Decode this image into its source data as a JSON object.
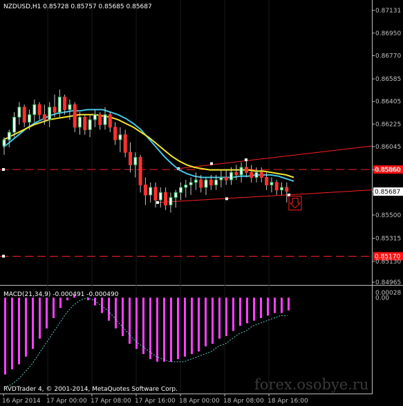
{
  "title": "NZDUSD,H1  0.85728 0.85757 0.85685 0.85687",
  "colors": {
    "background": "#000000",
    "bull_candle": "#20b050",
    "bear_candle": "#ff3030",
    "ma_fast": "#44c8e8",
    "ma_slow": "#f5e82a",
    "trend_lines": "#ff2020",
    "macd_hist": "#ff40ff",
    "macd_signal": "#60d0d0"
  },
  "chart_data": [
    {
      "type": "candlestick",
      "symbol": "NZDUSD",
      "timeframe": "H1",
      "ohlc_header": {
        "open": 0.85728,
        "high": 0.85757,
        "low": 0.85685,
        "close": 0.85687
      },
      "ylim": [
        0.84965,
        0.87131
      ],
      "y_ticks": [
        "0.87131",
        "0.86950",
        "0.86770",
        "0.86585",
        "0.86405",
        "0.86225",
        "0.86045",
        "0.85860",
        "0.85687",
        "0.85500",
        "0.85315",
        "0.85130",
        "0.84965"
      ],
      "current_price": "0.85687",
      "highlight_levels": [
        {
          "label": "0.85860",
          "value": 0.85863
        },
        {
          "label": "0.85170",
          "value": 0.85172
        }
      ],
      "x_labels": [
        "16 Apr 2014",
        "17 Apr 00:00",
        "17 Apr 08:00",
        "17 Apr 16:00",
        "18 Apr 00:00",
        "18 Apr 08:00",
        "18 Apr 16:00"
      ],
      "candles": [
        [
          0.8605,
          0.8612,
          0.8598,
          0.861
        ],
        [
          0.861,
          0.8618,
          0.8604,
          0.8616
        ],
        [
          0.8616,
          0.8632,
          0.8612,
          0.8628
        ],
        [
          0.8628,
          0.864,
          0.8622,
          0.8636
        ],
        [
          0.8636,
          0.8638,
          0.862,
          0.8624
        ],
        [
          0.8624,
          0.8634,
          0.8618,
          0.863
        ],
        [
          0.863,
          0.8642,
          0.8624,
          0.8638
        ],
        [
          0.8638,
          0.864,
          0.8626,
          0.863
        ],
        [
          0.863,
          0.8638,
          0.8622,
          0.8626
        ],
        [
          0.8626,
          0.864,
          0.862,
          0.8636
        ],
        [
          0.8636,
          0.8646,
          0.8628,
          0.8632
        ],
        [
          0.8632,
          0.865,
          0.8628,
          0.8644
        ],
        [
          0.8644,
          0.8646,
          0.863,
          0.8634
        ],
        [
          0.8634,
          0.8642,
          0.8626,
          0.8638
        ],
        [
          0.8638,
          0.864,
          0.8616,
          0.862
        ],
        [
          0.862,
          0.8632,
          0.8614,
          0.8628
        ],
        [
          0.8628,
          0.863,
          0.8614,
          0.8618
        ],
        [
          0.8618,
          0.863,
          0.8612,
          0.8626
        ],
        [
          0.8626,
          0.8634,
          0.862,
          0.863
        ],
        [
          0.863,
          0.8632,
          0.8618,
          0.8622
        ],
        [
          0.8622,
          0.8636,
          0.8618,
          0.863
        ],
        [
          0.863,
          0.8632,
          0.8616,
          0.862
        ],
        [
          0.862,
          0.8624,
          0.8606,
          0.861
        ],
        [
          0.861,
          0.862,
          0.86,
          0.8614
        ],
        [
          0.8614,
          0.8618,
          0.8596,
          0.86
        ],
        [
          0.86,
          0.8608,
          0.8584,
          0.859
        ],
        [
          0.859,
          0.86,
          0.858,
          0.8596
        ],
        [
          0.8596,
          0.8598,
          0.8568,
          0.8574
        ],
        [
          0.8574,
          0.858,
          0.8558,
          0.8566
        ],
        [
          0.8566,
          0.8576,
          0.856,
          0.8572
        ],
        [
          0.8572,
          0.8576,
          0.8556,
          0.8562
        ],
        [
          0.8562,
          0.8572,
          0.8556,
          0.8568
        ],
        [
          0.8568,
          0.8572,
          0.8554,
          0.8558
        ],
        [
          0.8558,
          0.8568,
          0.8552,
          0.8564
        ],
        [
          0.8564,
          0.857,
          0.8556,
          0.8568
        ],
        [
          0.8568,
          0.8576,
          0.8562,
          0.8572
        ],
        [
          0.8572,
          0.8578,
          0.8564,
          0.8574
        ],
        [
          0.8574,
          0.858,
          0.8566,
          0.8576
        ],
        [
          0.8576,
          0.8584,
          0.857,
          0.8578
        ],
        [
          0.8578,
          0.8582,
          0.8568,
          0.8572
        ],
        [
          0.8572,
          0.858,
          0.8566,
          0.8578
        ],
        [
          0.8578,
          0.8582,
          0.857,
          0.8574
        ],
        [
          0.8574,
          0.8582,
          0.857,
          0.8578
        ],
        [
          0.8578,
          0.8586,
          0.8572,
          0.858
        ],
        [
          0.858,
          0.8586,
          0.8574,
          0.8578
        ],
        [
          0.8578,
          0.8588,
          0.8574,
          0.8584
        ],
        [
          0.8584,
          0.859,
          0.8578,
          0.8582
        ],
        [
          0.8582,
          0.8592,
          0.8576,
          0.8588
        ],
        [
          0.8588,
          0.8594,
          0.858,
          0.8584
        ],
        [
          0.8584,
          0.859,
          0.8576,
          0.858
        ],
        [
          0.858,
          0.8588,
          0.8576,
          0.8584
        ],
        [
          0.8584,
          0.8588,
          0.8576,
          0.858
        ],
        [
          0.858,
          0.8584,
          0.857,
          0.8574
        ],
        [
          0.8574,
          0.858,
          0.8568,
          0.8576
        ],
        [
          0.8576,
          0.8578,
          0.8566,
          0.857
        ],
        [
          0.857,
          0.8576,
          0.8566,
          0.8572
        ],
        [
          0.8572,
          0.8576,
          0.856,
          0.8569
        ]
      ],
      "moving_averages": [
        {
          "color": "ma_fast",
          "values": [
            0.8604,
            0.8609,
            0.8614,
            0.8619,
            0.8623,
            0.8626,
            0.8629,
            0.8631,
            0.8632,
            0.8633,
            0.8633,
            0.8634,
            0.8634,
            0.8634,
            0.8632,
            0.863,
            0.8627,
            0.8623,
            0.8618,
            0.8611,
            0.8604,
            0.8597,
            0.8591,
            0.8586,
            0.8583,
            0.8581,
            0.858,
            0.858,
            0.858,
            0.858,
            0.858,
            0.8581,
            0.8581,
            0.8582,
            0.8582,
            0.8582,
            0.8581,
            0.8579,
            0.8577
          ]
        },
        {
          "color": "ma_slow",
          "values": [
            0.861,
            0.8613,
            0.8616,
            0.8619,
            0.8622,
            0.8624,
            0.8626,
            0.8627,
            0.8628,
            0.8629,
            0.863,
            0.863,
            0.863,
            0.8629,
            0.8628,
            0.8626,
            0.8623,
            0.862,
            0.8616,
            0.8612,
            0.8607,
            0.8602,
            0.8597,
            0.8593,
            0.859,
            0.8588,
            0.8587,
            0.8586,
            0.8586,
            0.8586,
            0.8586,
            0.8586,
            0.8586,
            0.8585,
            0.8585,
            0.8584,
            0.8583,
            0.8582,
            0.858
          ]
        }
      ]
    },
    {
      "type": "bar",
      "indicator": "MACD",
      "label": "MACD(21,34,9) -0.000491 -0.000490",
      "ylim": [
        -0.0035,
        0.00028
      ],
      "y_ticks": [
        "0.00028",
        "0.00"
      ],
      "values": [
        -0.003,
        -0.0028,
        -0.0026,
        -0.0023,
        -0.002,
        -0.0016,
        -0.0012,
        -0.0008,
        -0.0004,
        -0.0001,
        0.0001,
        0.0,
        -0.0001,
        -0.0003,
        -0.0006,
        -0.0009,
        -0.0012,
        -0.0015,
        -0.0018,
        -0.002,
        -0.0022,
        -0.0024,
        -0.0025,
        -0.0025,
        -0.0025,
        -0.0024,
        -0.0023,
        -0.0022,
        -0.0021,
        -0.0019,
        -0.0018,
        -0.0016,
        -0.0015,
        -0.0013,
        -0.0011,
        -0.001,
        -0.0009,
        -0.0008,
        -0.0007,
        -0.0006,
        -0.0006,
        -0.0005
      ],
      "signal": [
        -0.0035,
        -0.0034,
        -0.0032,
        -0.0029,
        -0.0026,
        -0.0022,
        -0.0018,
        -0.0014,
        -0.001,
        -0.0006,
        -0.0003,
        -0.0001,
        0.0,
        -0.0001,
        -0.0003,
        -0.0005,
        -0.0008,
        -0.0011,
        -0.0014,
        -0.0017,
        -0.0019,
        -0.0021,
        -0.0023,
        -0.0024,
        -0.0025,
        -0.0025,
        -0.0025,
        -0.0024,
        -0.0023,
        -0.0022,
        -0.0021,
        -0.0019,
        -0.0018,
        -0.0016,
        -0.0014,
        -0.0013,
        -0.0011,
        -0.001,
        -0.0009,
        -0.0008,
        -0.0007,
        -0.0007
      ]
    }
  ],
  "copyright": "RVDTrader 4, © 2001-2014, MetaQuotes Software Corp.",
  "watermark": "forex.osobye.ru"
}
